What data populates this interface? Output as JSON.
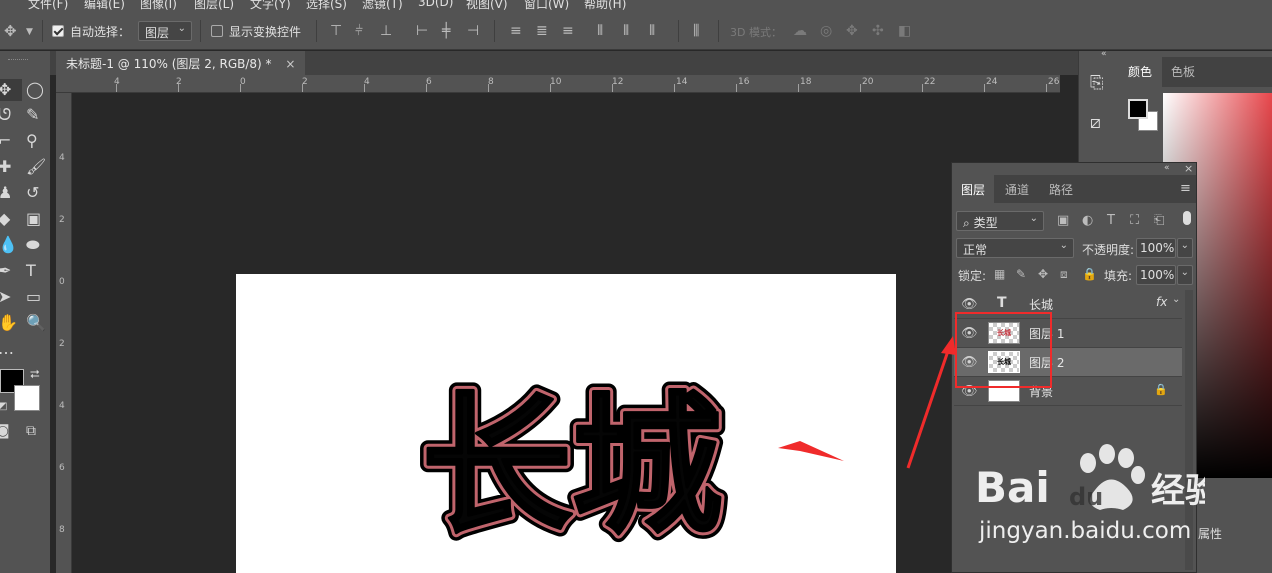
{
  "menubar": {
    "items": [
      "文件(F)",
      "编辑(E)",
      "图像(I)",
      "图层(L)",
      "文字(Y)",
      "选择(S)",
      "滤镜(T)",
      "3D(D)",
      "视图(V)",
      "窗口(W)",
      "帮助(H)"
    ]
  },
  "options": {
    "auto_select_label": "自动选择：",
    "auto_select_value": "图层",
    "show_transform_label": "显示变换控件",
    "mode_3d_label": "3D 模式："
  },
  "document": {
    "tab_title": "未标题-1 @ 110% (图层 2, RGB/8) *",
    "close_glyph": "×",
    "art_text": "长城"
  },
  "ruler": {
    "top_labels": [
      "4",
      "2",
      "0",
      "2",
      "4",
      "6",
      "8",
      "10",
      "12",
      "14",
      "16",
      "18",
      "20",
      "22",
      "24",
      "26"
    ],
    "left_labels": [
      "4",
      "2",
      "0",
      "2",
      "4",
      "6",
      "8"
    ]
  },
  "color_panel": {
    "tabs": [
      "颜色",
      "色板"
    ],
    "foreground": "#000000",
    "background": "#ffffff"
  },
  "layers_panel": {
    "tabs": [
      "图层",
      "通道",
      "路径"
    ],
    "filter_label": "类型",
    "blend_mode": "正常",
    "opacity_label": "不透明度:",
    "opacity_value": "100%",
    "lock_label": "锁定:",
    "fill_label": "填充:",
    "fill_value": "100%",
    "layers": [
      {
        "name": "长城",
        "type": "text",
        "fx": "fx"
      },
      {
        "name": "图层 1",
        "type": "pixel",
        "thumb_text": "长城"
      },
      {
        "name": "图层 2",
        "type": "pixel",
        "thumb_text": "长城",
        "selected": true
      },
      {
        "name": "背景",
        "type": "background",
        "locked": true
      }
    ]
  },
  "properties_label": "属性",
  "watermark": {
    "brand": "Bai",
    "brand2": "du",
    "suffix": "经验",
    "url": "jingyan.baidu.com"
  },
  "colors": {
    "ui_bg": "#535353",
    "canvas_bg": "#282828",
    "annotation_red": "#f02b2b",
    "text_stroke": "#c0646c"
  }
}
